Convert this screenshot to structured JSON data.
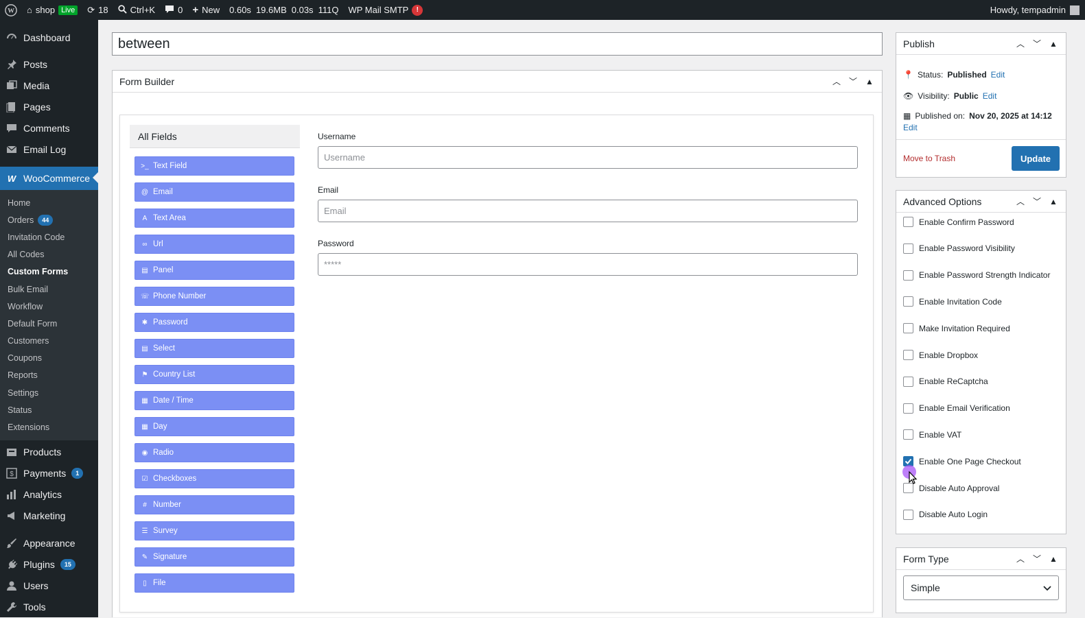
{
  "adminbar": {
    "site": "shop",
    "live": "Live",
    "updates": "18",
    "search": "Ctrl+K",
    "comments": "0",
    "new": "New",
    "perf_time": "0.60s",
    "perf_mem": "19.6MB",
    "perf_q_time": "0.03s",
    "perf_queries": "111Q",
    "smtp": "WP Mail SMTP",
    "smtp_alert": "!",
    "howdy": "Howdy, tempadmin"
  },
  "sidebar": {
    "top": [
      {
        "label": "Dashboard"
      },
      {
        "label": "Posts"
      },
      {
        "label": "Media"
      },
      {
        "label": "Pages"
      },
      {
        "label": "Comments"
      },
      {
        "label": "Email Log"
      },
      {
        "label": "WooCommerce"
      }
    ],
    "woo_sub": [
      {
        "label": "Home"
      },
      {
        "label": "Orders",
        "count": "44"
      },
      {
        "label": "Invitation Code"
      },
      {
        "label": "All Codes"
      },
      {
        "label": "Custom Forms"
      },
      {
        "label": "Bulk Email"
      },
      {
        "label": "Workflow"
      },
      {
        "label": "Default Form"
      },
      {
        "label": "Customers"
      },
      {
        "label": "Coupons"
      },
      {
        "label": "Reports"
      },
      {
        "label": "Settings"
      },
      {
        "label": "Status"
      },
      {
        "label": "Extensions"
      }
    ],
    "bottom": [
      {
        "label": "Products"
      },
      {
        "label": "Payments",
        "count": "1"
      },
      {
        "label": "Analytics"
      },
      {
        "label": "Marketing"
      },
      {
        "label": "Appearance"
      },
      {
        "label": "Plugins",
        "count": "15"
      },
      {
        "label": "Users"
      },
      {
        "label": "Tools"
      }
    ]
  },
  "post": {
    "title": "between"
  },
  "form_builder": {
    "title": "Form Builder",
    "fields_heading": "All Fields",
    "fields": [
      "Text Field",
      "Email",
      "Text Area",
      "Url",
      "Panel",
      "Phone Number",
      "Password",
      "Select",
      "Country List",
      "Date / Time",
      "Day",
      "Radio",
      "Checkboxes",
      "Number",
      "Survey",
      "Signature",
      "File"
    ],
    "form": {
      "username_label": "Username",
      "username_placeholder": "Username",
      "email_label": "Email",
      "email_placeholder": "Email",
      "password_label": "Password",
      "password_placeholder": "*****"
    }
  },
  "publish": {
    "title": "Publish",
    "status_label": "Status:",
    "status_value": "Published",
    "visibility_label": "Visibility:",
    "visibility_value": "Public",
    "published_label": "Published on:",
    "published_value": "Nov 20, 2025 at 14:12",
    "edit": "Edit",
    "trash": "Move to Trash",
    "update": "Update"
  },
  "advanced": {
    "title": "Advanced Options",
    "options": [
      {
        "label": "Enable Confirm Password",
        "checked": false
      },
      {
        "label": "Enable Password Visibility",
        "checked": false
      },
      {
        "label": "Enable Password Strength Indicator",
        "checked": false
      },
      {
        "label": "Enable Invitation Code",
        "checked": false
      },
      {
        "label": "Make Invitation Required",
        "checked": false
      },
      {
        "label": "Enable Dropbox",
        "checked": false
      },
      {
        "label": "Enable ReCaptcha",
        "checked": false
      },
      {
        "label": "Enable Email Verification",
        "checked": false
      },
      {
        "label": "Enable VAT",
        "checked": false
      },
      {
        "label": "Enable One Page Checkout",
        "checked": true
      },
      {
        "label": "Disable Auto Approval",
        "checked": false
      },
      {
        "label": "Disable Auto Login",
        "checked": false
      }
    ]
  },
  "form_type": {
    "title": "Form Type",
    "selected": "Simple"
  }
}
